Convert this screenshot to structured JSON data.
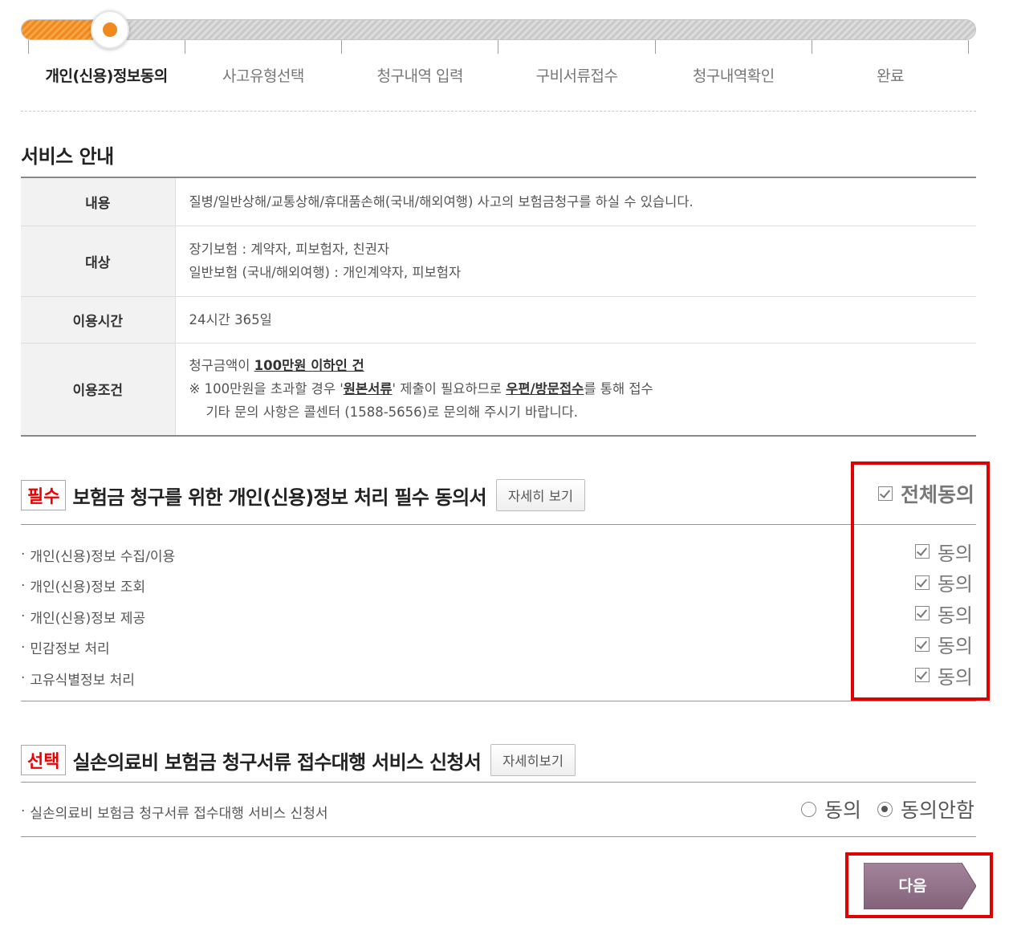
{
  "steps": [
    "개인(신용)정보동의",
    "사고유형선택",
    "청구내역 입력",
    "구비서류접수",
    "청구내역확인",
    "완료"
  ],
  "progress": {
    "current_step": 1,
    "total_steps": 6
  },
  "service": {
    "title": "서비스 안내",
    "rows": [
      {
        "label": "내용",
        "lines": [
          "질병/일반상해/교통상해/휴대품손해(국내/해외여행) 사고의 보험금청구를 하실 수 있습니다."
        ]
      },
      {
        "label": "대상",
        "lines": [
          "장기보험 : 계약자, 피보험자, 친권자",
          "일반보험 (국내/해외여행) : 개인계약자, 피보험자"
        ]
      },
      {
        "label": "이용시간",
        "lines": [
          "24시간 365일"
        ]
      },
      {
        "label": "이용조건",
        "line1_pre": "청구금액이 ",
        "line1_u": "100만원 이하인 건",
        "line2_pre": "※ 100만원을 초과할 경우 '",
        "line2_u1": "원본서류",
        "line2_mid": "' 제출이 필요하므로 ",
        "line2_u2": "우편/방문접수",
        "line2_post": "를 통해 접수",
        "line3": "기타 문의 사항은 콜센터 (1588-5656)로 문의해 주시기 바랍니다."
      }
    ]
  },
  "required": {
    "badge": "필수",
    "title": "보험금 청구를 위한 개인(신용)정보 처리 필수 동의서",
    "detail_btn": "자세히 보기",
    "all_agree": "전체동의",
    "items": [
      {
        "label": "개인(신용)정보 수집/이용",
        "agree": "동의",
        "checked": true
      },
      {
        "label": "개인(신용)정보 조회",
        "agree": "동의",
        "checked": true
      },
      {
        "label": "개인(신용)정보 제공",
        "agree": "동의",
        "checked": true
      },
      {
        "label": "민감정보 처리",
        "agree": "동의",
        "checked": true
      },
      {
        "label": "고유식별정보 처리",
        "agree": "동의",
        "checked": true
      }
    ]
  },
  "optional": {
    "badge": "선택",
    "title": "실손의료비 보험금 청구서류 접수대행 서비스 신청서",
    "detail_btn": "자세히보기",
    "item": "실손의료비 보험금 청구서류 접수대행 서비스 신청서",
    "agree": "동의",
    "disagree": "동의안함",
    "selected": "동의안함"
  },
  "next_button": "다음",
  "colors": {
    "accent_orange": "#f08a1e",
    "required_red": "#e00000",
    "next_purple": "#8e6e86",
    "highlight_box": "#e00000"
  }
}
